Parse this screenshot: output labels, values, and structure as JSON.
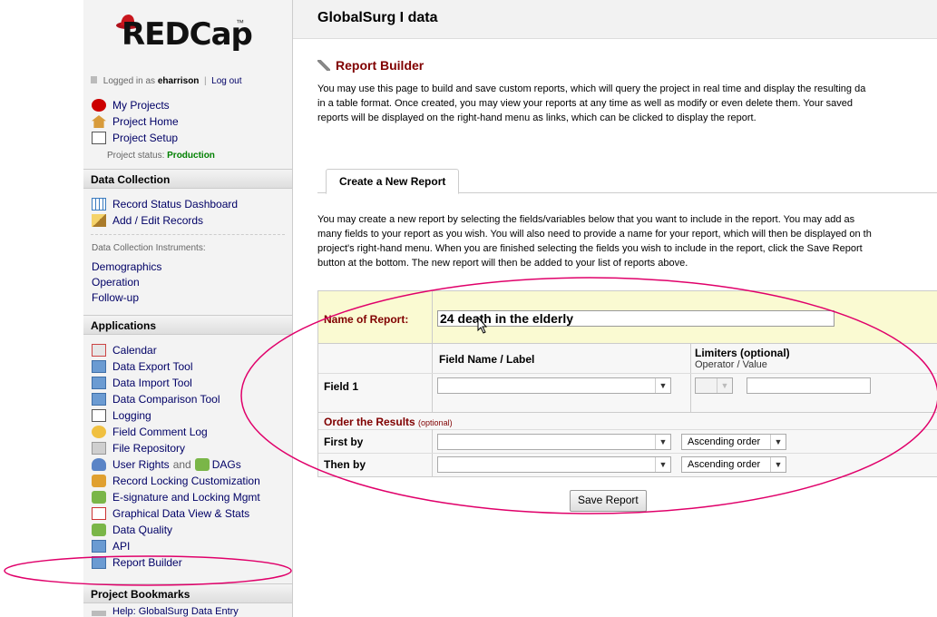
{
  "sidebar": {
    "logo": "REDCap",
    "logo_tm": "™",
    "logged_in_prefix": "Logged in as",
    "username": "eharrison",
    "logout": "Log out",
    "links": [
      {
        "label": "My Projects",
        "icon": "red-hat-icon"
      },
      {
        "label": "Project Home",
        "icon": "house-icon"
      },
      {
        "label": "Project Setup",
        "icon": "checklist-icon"
      }
    ],
    "status_label": "Project status:",
    "status_value": "Production",
    "data_collection": {
      "title": "Data Collection",
      "links": [
        {
          "label": "Record Status Dashboard",
          "icon": "grid-icon"
        },
        {
          "label": "Add / Edit Records",
          "icon": "pencil-icon"
        }
      ],
      "instruments_label": "Data Collection Instruments:",
      "instruments": [
        "Demographics",
        "Operation",
        "Follow-up"
      ]
    },
    "applications": {
      "title": "Applications",
      "links": [
        {
          "label": "Calendar",
          "icon": "calendar-icon"
        },
        {
          "label": "Data Export Tool",
          "icon": "export-icon"
        },
        {
          "label": "Data Import Tool",
          "icon": "import-icon"
        },
        {
          "label": "Data Comparison Tool",
          "icon": "compare-icon"
        },
        {
          "label": "Logging",
          "icon": "log-icon"
        },
        {
          "label": "Field Comment Log",
          "icon": "comment-icon"
        },
        {
          "label": "File Repository",
          "icon": "folder-icon"
        },
        {
          "label": "User Rights",
          "and": "and",
          "label2": "DAGs",
          "icon": "user-icon"
        },
        {
          "label": "Record Locking Customization",
          "icon": "lock-icon"
        },
        {
          "label": "E-signature and Locking Mgmt",
          "icon": "signature-icon"
        },
        {
          "label": "Graphical Data View & Stats",
          "icon": "chart-icon"
        },
        {
          "label": "Data Quality",
          "icon": "quality-icon"
        },
        {
          "label": "API",
          "icon": "api-icon"
        },
        {
          "label": "Report Builder",
          "icon": "report-icon"
        }
      ]
    },
    "bookmarks": {
      "title": "Project Bookmarks",
      "links": [
        {
          "label": "Help: GlobalSurg Data Entry",
          "icon": "link-icon"
        }
      ]
    }
  },
  "main": {
    "project_title": "GlobalSurg I data",
    "page_title": "Report Builder",
    "intro_lines": [
      "You may use this page to build and save custom reports, which will query the project in real time and display the resulting da",
      "in a table format. Once created, you may view your reports at any time as well as modify or even delete them. Your saved",
      "reports will be displayed on the right-hand menu as links, which can be clicked to display the report."
    ],
    "tab_label": "Create a New Report",
    "create_lines": [
      "You may create a new report by selecting the fields/variables below that you want to include in the report. You may add as",
      "many fields to your report as you wish. You will also need to provide a name for your report, which will then be displayed on th",
      "project's right-hand menu. When you are finished selecting the fields you wish to include in the report, click the Save Report",
      "button at the bottom. The new report will then be added to your list of reports above."
    ],
    "form": {
      "name_label": "Name of Report:",
      "name_value": "24 death in the elderly",
      "field_header": "Field Name / Label",
      "limiters_header": "Limiters (optional)",
      "limiters_sub": "Operator / Value",
      "field1_label": "Field 1",
      "order_title": "Order the Results",
      "order_optional": "(optional)",
      "first_by": "First by",
      "then_by": "Then by",
      "ascending": "Ascending order",
      "save_button": "Save Report"
    },
    "colors": {
      "accent": "#800000",
      "link": "#000066",
      "status_green": "#008000",
      "annotation": "#e0006a"
    }
  }
}
